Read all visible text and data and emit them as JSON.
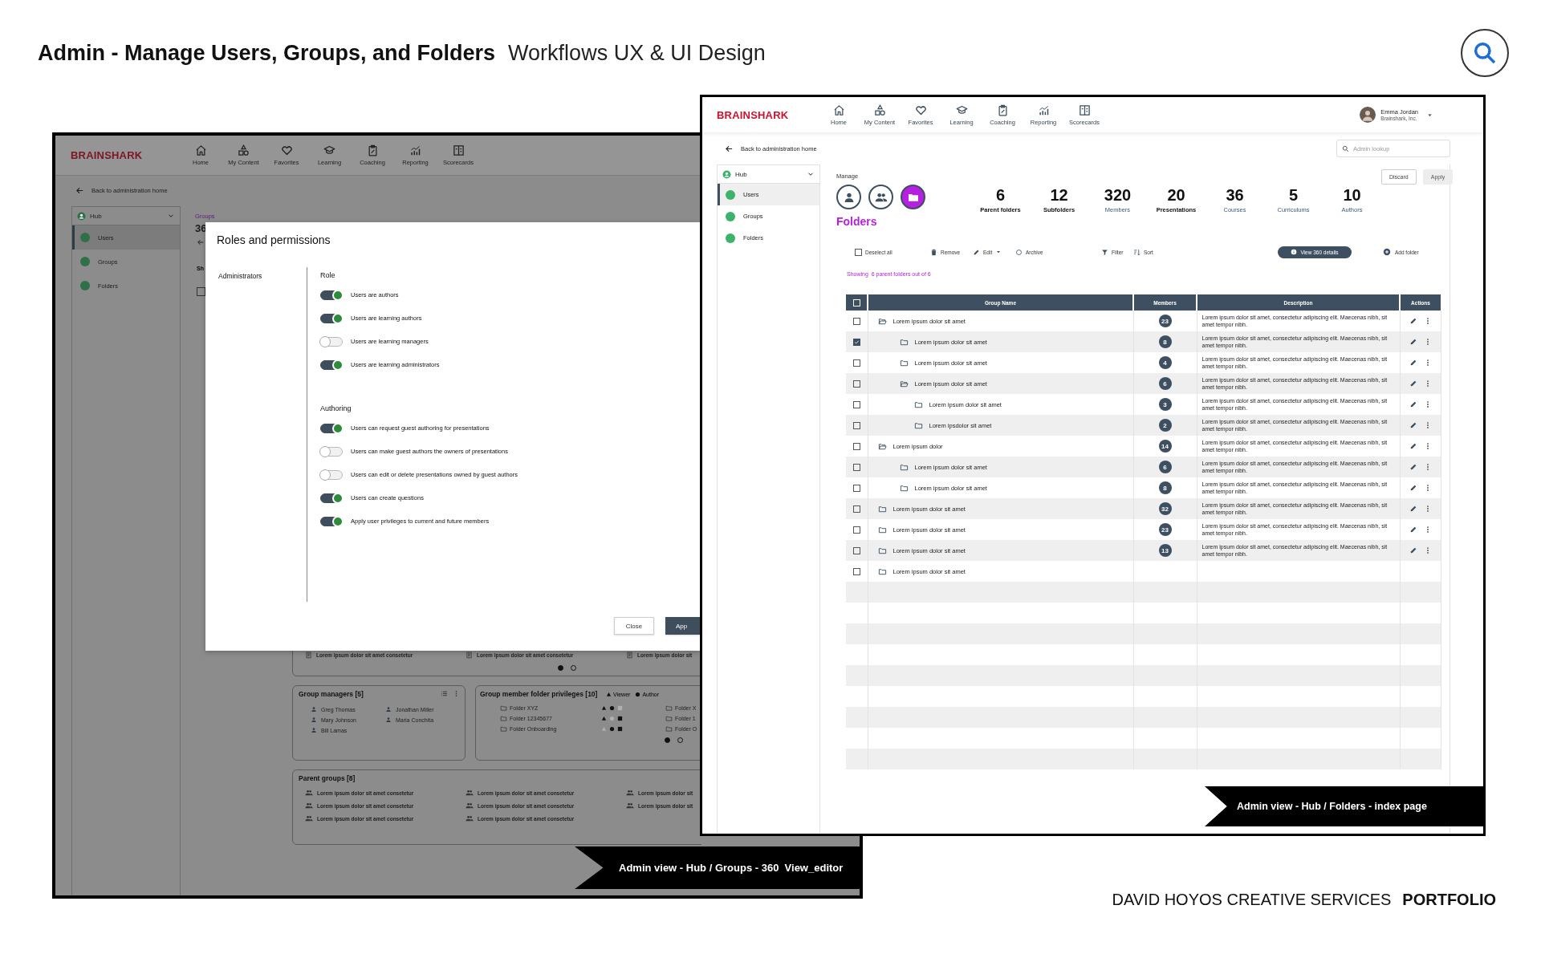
{
  "heading": {
    "title": "Admin - Manage Users, Groups, and Folders",
    "subtitle": "Workflows UX & UI Design"
  },
  "groups_screen": {
    "brand": "BRAINSHARK",
    "nav": [
      "Home",
      "My Content",
      "Favorites",
      "Learning",
      "Coaching",
      "Reporting",
      "Scorecards"
    ],
    "back_link": "Back to administration home",
    "sidebar": {
      "hub": "Hub",
      "items": [
        {
          "label": "Users",
          "selected": true
        },
        {
          "label": "Groups",
          "selected": false
        },
        {
          "label": "Folders",
          "selected": false
        }
      ]
    },
    "breadcrumb": "Groups",
    "count": "36",
    "column_1": "Sh",
    "select_all": {
      "checked": false
    },
    "modal": {
      "title": "Roles and permissions",
      "category": "Administrators",
      "sections": [
        {
          "heading": "Role",
          "toggles": [
            {
              "label": "Users are authors",
              "on": true
            },
            {
              "label": "Users are learning authors",
              "on": true
            },
            {
              "label": "Users are learning managers",
              "on": false
            },
            {
              "label": "Users are learning administrators",
              "on": true
            }
          ]
        },
        {
          "heading": "Authoring",
          "toggles": [
            {
              "label": "Users can request guest authoring for presentations",
              "on": true
            },
            {
              "label": "Users can make guest authors the owners of presentations",
              "on": false
            },
            {
              "label": "Users can edit or delete presentations owned by guest authors",
              "on": false
            },
            {
              "label": "Users can create questions",
              "on": true
            },
            {
              "label": "Apply user privileges to current and future members",
              "on": true
            }
          ]
        }
      ],
      "buttons": [
        "Close",
        "App"
      ]
    },
    "content_items": [
      "Lorem ipsum dolor sit amet consetetur",
      "Lorem ipsum dolor sit amet consetetur",
      "Lorem ipsum dolor sit"
    ],
    "content_pages": [
      {
        "selected": true
      },
      {
        "selected": false
      }
    ],
    "group_managers": {
      "title": "Group managers [5]",
      "members": [
        "Greg Thomas",
        "Jonathan Miller",
        "Mary Johnson",
        "Maria Conchita",
        "Bill Lamas"
      ]
    },
    "folder_privileges": {
      "title": "Group member folder privileges [10]",
      "legend": [
        {
          "kind": "triangle",
          "label": "Viewer"
        },
        {
          "kind": "circle",
          "label": "Author"
        }
      ],
      "folders": [
        {
          "name": "Folder XYZ",
          "marks": [
            true,
            true,
            false
          ]
        },
        {
          "name": "Folder 12345677",
          "marks": [
            true,
            false,
            true
          ]
        },
        {
          "name": "Folder Onboarding",
          "marks": [
            false,
            true,
            true
          ]
        }
      ],
      "folders_column_2": [
        "Folder X",
        "Folder 1",
        "Folder O"
      ],
      "pages": [
        {
          "selected": true
        },
        {
          "selected": false
        }
      ]
    },
    "parent_groups": {
      "title": "Parent groups [8]",
      "items": [
        "Lorem ipsum dolor sit amet consetetur",
        "Lorem ipsum dolor sit amet consetetur",
        "Lorem ipsum dolor sit",
        "Lorem ipsum dolor sit amet consetetur",
        "Lorem ipsum dolor sit amet consetetur",
        "Lorem ipsum dolor sit",
        "Lorem ipsum dolor sit amet consetetur",
        "Lorem ipsum dolor sit amet consetetur"
      ]
    },
    "caption": "Admin view - Hub / Groups - 360  View_editor"
  },
  "folders_screen": {
    "brand": "BRAINSHARK",
    "nav": [
      "Home",
      "My Content",
      "Favorites",
      "Learning",
      "Coaching",
      "Reporting",
      "Scorecards"
    ],
    "user": {
      "name": "Emma Jordan",
      "company": "Brainshark, Inc."
    },
    "back_link": "Back to administration home",
    "search": {
      "placeholder": "Admin lookup"
    },
    "sidebar": {
      "hub": "Hub",
      "items": [
        {
          "label": "Users",
          "selected": true
        },
        {
          "label": "Groups",
          "selected": false
        },
        {
          "label": "Folders",
          "selected": false
        }
      ]
    },
    "manage_label": "Manage",
    "manage_modes": [
      {
        "kind": "user",
        "selected": false
      },
      {
        "kind": "group",
        "selected": false
      },
      {
        "kind": "folder",
        "selected": true
      }
    ],
    "section_title": "Folders",
    "stats": [
      {
        "value": "6",
        "label": "Parent folders",
        "emphasis": true
      },
      {
        "value": "12",
        "label": "Subfolders",
        "emphasis": true
      },
      {
        "value": "320",
        "label": "Members",
        "emphasis": false
      },
      {
        "value": "20",
        "label": "Presentations",
        "emphasis": true
      },
      {
        "value": "36",
        "label": "Courses",
        "emphasis": false
      },
      {
        "value": "5",
        "label": "Curriculums",
        "emphasis": false
      },
      {
        "value": "10",
        "label": "Authors",
        "emphasis": false
      }
    ],
    "actions": [
      "Discard",
      "Apply"
    ],
    "toolbar": {
      "deselect": {
        "label": "Deselect all",
        "checked": false
      },
      "tools": [
        {
          "label": "Remove",
          "menu": false
        },
        {
          "label": "Edit",
          "menu": true
        },
        {
          "label": "Archive",
          "menu": false
        },
        {
          "label": "Filter",
          "menu": false
        },
        {
          "label": "Sort",
          "menu": false
        }
      ],
      "details_button": "View 360 details",
      "add_button": "Add folder"
    },
    "showing": {
      "prefix": "Showing",
      "text": "6 parent folders out of 6"
    },
    "table": {
      "columns": [
        "Group Name",
        "Members",
        "Description",
        "Actions"
      ],
      "select_all": false,
      "rows": [
        {
          "name": "Lorem ipsum dolor sit amet",
          "members": "23",
          "description": "Lorem ipsum dolor sit amet, consectetur adipiscing elit. Maecenas nibh, sit amet tempor nibh.",
          "checked": false,
          "expanded": true,
          "children": [
            {
              "name": "Lorem ipsum dolor sit amet",
              "members": "8",
              "description": "Lorem ipsum dolor sit amet, consectetur adipiscing elit. Maecenas nibh, sit amet tempor nibh.",
              "checked": true,
              "expanded": false
            },
            {
              "name": "Lorem ipsum dolor sit amet",
              "members": "4",
              "description": "Lorem ipsum dolor sit amet, consectetur adipiscing elit. Maecenas nibh, sit amet tempor nibh.",
              "checked": false,
              "expanded": false
            },
            {
              "name": "Lorem ipsum dolor sit amet",
              "members": "6",
              "description": "Lorem ipsum dolor sit amet, consectetur adipiscing elit. Maecenas nibh, sit amet tempor nibh.",
              "checked": false,
              "expanded": true,
              "children": [
                {
                  "name": "Lorem ipsum dolor sit amet",
                  "members": "3",
                  "description": "Lorem ipsum dolor sit amet, consectetur adipiscing elit. Maecenas nibh, sit amet tempor nibh.",
                  "checked": false,
                  "expanded": false
                },
                {
                  "name": "Lorem ipsdolor sit amet",
                  "members": "2",
                  "description": "Lorem ipsum dolor sit amet, consectetur adipiscing elit. Maecenas nibh, sit amet tempor nibh.",
                  "checked": false,
                  "expanded": false
                }
              ]
            }
          ]
        },
        {
          "name": "Lorem ipsum dolor",
          "members": "14",
          "description": "Lorem ipsum dolor sit amet, consectetur adipiscing elit. Maecenas nibh, sit amet tempor nibh.",
          "checked": false,
          "expanded": true,
          "children": [
            {
              "name": "Lorem ipsum dolor sit amet",
              "members": "6",
              "description": "Lorem ipsum dolor sit amet, consectetur adipiscing elit. Maecenas nibh, sit amet tempor nibh.",
              "checked": false,
              "expanded": false
            },
            {
              "name": "Lorem ipsum dolor sit amet",
              "members": "8",
              "description": "Lorem ipsum dolor sit amet, consectetur adipiscing elit. Maecenas nibh, sit amet tempor nibh.",
              "checked": false,
              "expanded": false
            }
          ]
        },
        {
          "name": "Lorem ipsum dolor sit amet",
          "members": "32",
          "description": "Lorem ipsum dolor sit amet, consectetur adipiscing elit. Maecenas nibh, sit amet tempor nibh.",
          "checked": false,
          "expanded": false
        },
        {
          "name": "Lorem ipsum dolor sit amet",
          "members": "23",
          "description": "Lorem ipsum dolor sit amet, consectetur adipiscing elit. Maecenas nibh, sit amet tempor nibh.",
          "checked": false,
          "expanded": false
        },
        {
          "name": "Lorem ipsum dolor sit amet",
          "members": "13",
          "description": "Lorem ipsum dolor sit amet, consectetur adipiscing elit. Maecenas nibh, sit amet tempor nibh.",
          "checked": false,
          "expanded": false
        },
        {
          "name": "Lorem ipsum dolor sit amet",
          "checked": false,
          "expanded": false
        }
      ]
    },
    "caption": "Admin view - Hub / Folders - index page"
  },
  "footer": {
    "studio": "DAVID HOYOS CREATIVE SERVICES",
    "tag": "PORTFOLIO"
  }
}
